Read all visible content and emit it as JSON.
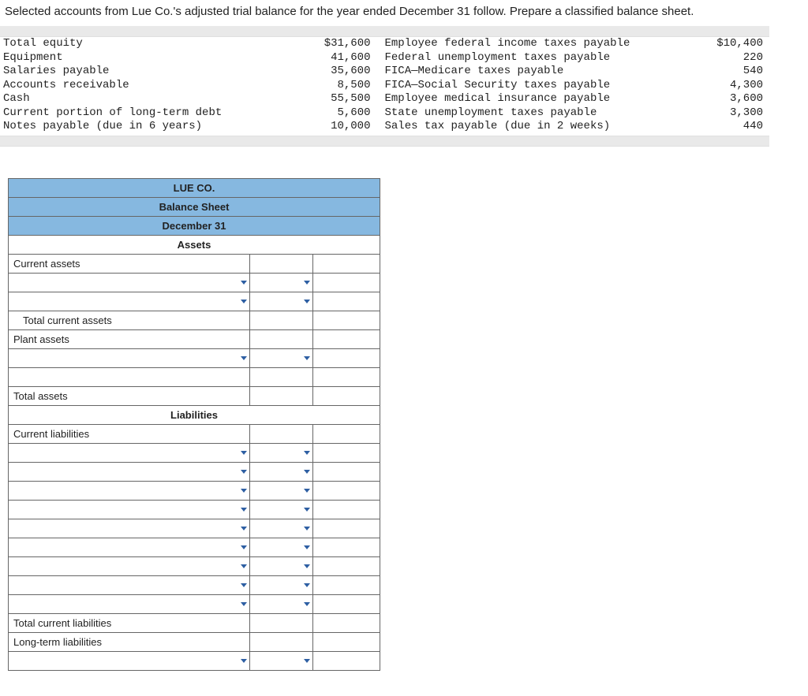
{
  "problem_text": "Selected accounts from Lue Co.'s adjusted trial balance for the year ended December 31 follow. Prepare a classified balance sheet.",
  "trial_balance": {
    "left": [
      {
        "label": "Total equity",
        "value": "$31,600"
      },
      {
        "label": "Equipment",
        "value": "41,600"
      },
      {
        "label": "Salaries payable",
        "value": "35,600"
      },
      {
        "label": "Accounts receivable",
        "value": "8,500"
      },
      {
        "label": "Cash",
        "value": "55,500"
      },
      {
        "label": "Current portion of long-term debt",
        "value": "5,600"
      },
      {
        "label": "Notes payable (due in 6 years)",
        "value": "10,000"
      }
    ],
    "right": [
      {
        "label": "Employee federal income taxes payable",
        "value": "$10,400"
      },
      {
        "label": "Federal unemployment taxes payable",
        "value": "220"
      },
      {
        "label": "FICA—Medicare taxes payable",
        "value": "540"
      },
      {
        "label": "FICA—Social Security taxes payable",
        "value": "4,300"
      },
      {
        "label": "Employee medical insurance payable",
        "value": "3,600"
      },
      {
        "label": "State unemployment taxes payable",
        "value": "3,300"
      },
      {
        "label": "Sales tax payable (due in 2 weeks)",
        "value": "440"
      }
    ]
  },
  "bs": {
    "company": "LUE CO.",
    "title": "Balance Sheet",
    "date": "December 31",
    "assets_header": "Assets",
    "liabilities_header": "Liabilities",
    "rows": {
      "current_assets": "Current assets",
      "total_current_assets": "Total current assets",
      "plant_assets": "Plant assets",
      "total_assets": "Total assets",
      "current_liabilities": "Current liabilities",
      "total_current_liabilities": "Total current liabilities",
      "long_term_liabilities": "Long-term liabilities"
    }
  }
}
